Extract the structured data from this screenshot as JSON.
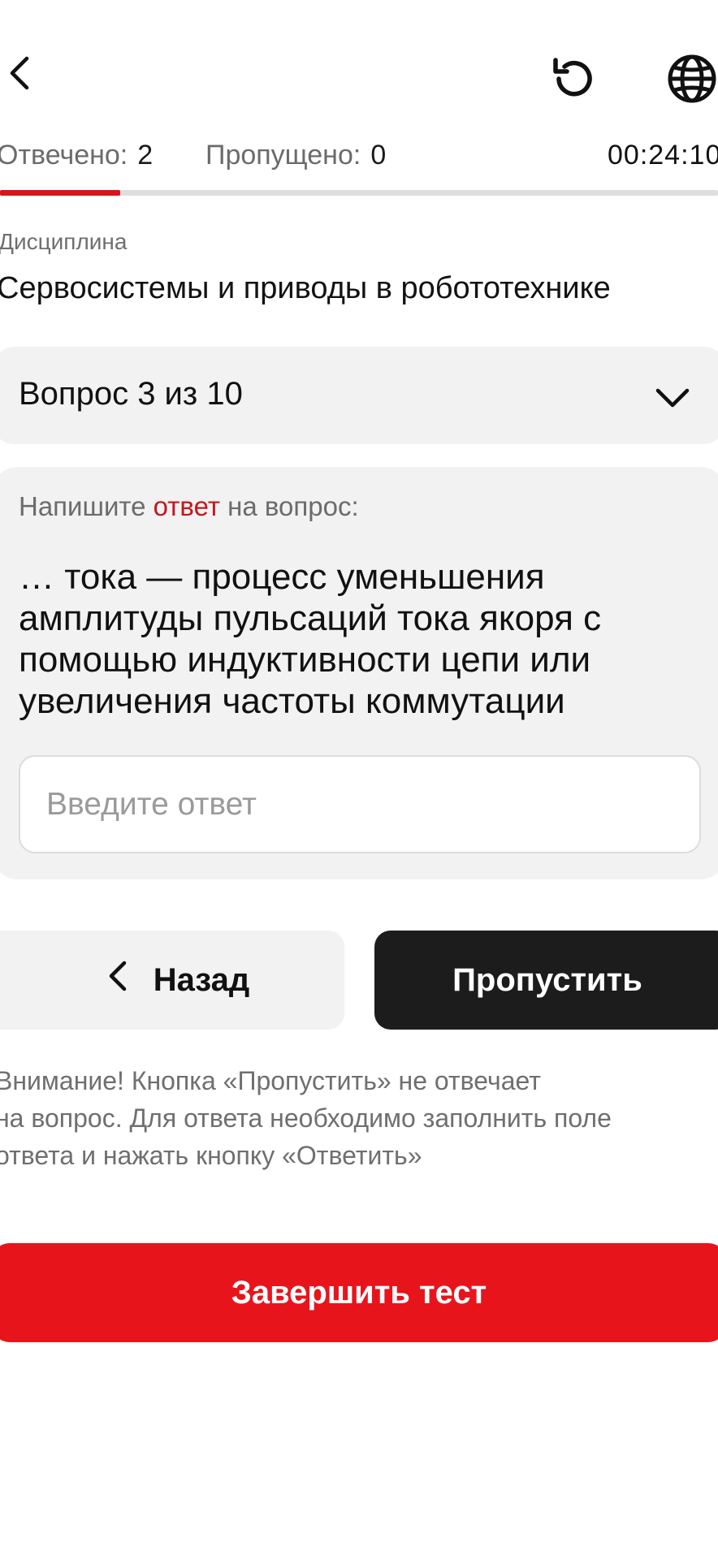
{
  "header": {
    "back_icon": "chevron-left-icon",
    "refresh_icon": "refresh-icon",
    "language_icon": "globe-icon"
  },
  "stats": {
    "answered_label": "Отвечено:",
    "answered_value": "2",
    "skipped_label": "Пропущено:",
    "skipped_value": "0",
    "timer": "00:24:10"
  },
  "progress": {
    "fraction": 0.167,
    "color": "#d8141d"
  },
  "discipline": {
    "label": "Дисциплина",
    "value": "Сервосистемы и приводы в робототехнике"
  },
  "question_selector": {
    "label": "Вопрос 3 из 10",
    "icon": "chevron-down-icon"
  },
  "question": {
    "prompt_before": "Напишите ",
    "prompt_accent": "ответ",
    "prompt_after": " на вопрос:",
    "text": "… тока — процесс уменьшения амплитуды пульсаций тока якоря с помощью индуктивности цепи или увеличения частоты коммутации",
    "input_placeholder": "Введите ответ",
    "input_value": ""
  },
  "actions": {
    "back_label": "Назад",
    "skip_label": "Пропустить",
    "finish_label": "Завершить тест"
  },
  "warning": {
    "line1": "Внимание! Кнопка «Пропустить» не отвечает",
    "line2": "на вопрос. Для ответа необходимо заполнить поле",
    "line3": "ответа и нажать кнопку «Ответить»"
  },
  "colors": {
    "accent_red": "#e8141c",
    "dark_button": "#1c1c1c",
    "card_bg": "#f2f2f2"
  }
}
